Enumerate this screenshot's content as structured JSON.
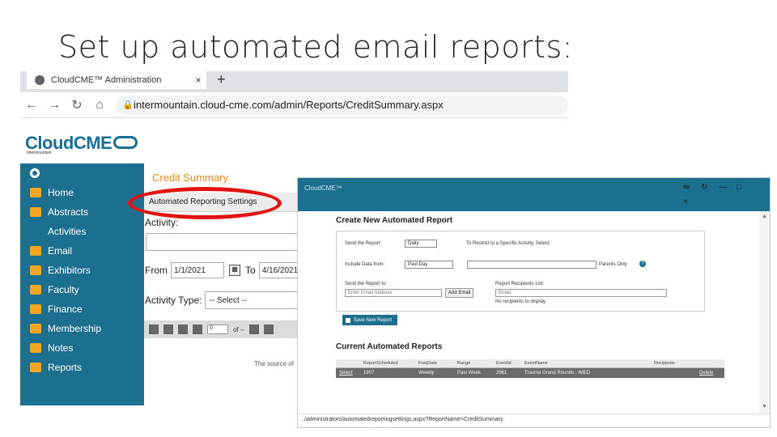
{
  "slide": {
    "title": "Set up automated email reports:"
  },
  "browser": {
    "tab_title": "CloudCME™ Administration",
    "tab_close": "×",
    "new_tab": "+",
    "nav": {
      "back": "←",
      "forward": "→",
      "reload": "↻",
      "home": "⌂"
    },
    "url": "intermountain.cloud-cme.com/admin/Reports/CreditSummary.aspx"
  },
  "site": {
    "logo": "CloudCME",
    "logo_sub": "Intermountain"
  },
  "sidebar": {
    "items": [
      {
        "label": "Home",
        "icon": "location-pin-icon"
      },
      {
        "label": "Abstracts",
        "icon": "book-icon"
      },
      {
        "label": "Activities",
        "icon": ""
      },
      {
        "label": "Email",
        "icon": "envelope-icon"
      },
      {
        "label": "Exhibitors",
        "icon": "grid-icon"
      },
      {
        "label": "Faculty",
        "icon": "person-icon"
      },
      {
        "label": "Finance",
        "icon": "pie-chart-icon"
      },
      {
        "label": "Membership",
        "icon": "group-icon"
      },
      {
        "label": "Notes",
        "icon": "list-icon"
      },
      {
        "label": "Reports",
        "icon": "bar-chart-icon"
      }
    ]
  },
  "main": {
    "heading": "Credit Summary",
    "active_tab": "Automated Reporting Settings",
    "activity_label": "Activity:",
    "from_label": "From",
    "from_date": "1/1/2021",
    "to_label": "To",
    "to_date": "4/16/2021",
    "activity_type_label": "Activity Type:",
    "activity_type_value": "-- Select --",
    "pager_page": "0",
    "pager_of": "of --",
    "source_note": "The source of"
  },
  "popup": {
    "title": "CloudCME™",
    "create_title": "Create New Automated Report",
    "send_report_label": "Send the Report:",
    "send_report_value": "Daily",
    "restrict_label": "To Restrict to a Specific Activity, Select:",
    "include_label": "Include Data from:",
    "include_value": "Past Day",
    "parents_only": "Parents Only",
    "send_to_label": "Send the Report to:",
    "email_placeholder": "Enter Email Address",
    "add_email": "Add Email",
    "recipients_label": "Report Recipients List:",
    "recipients_header": "Email",
    "no_recipients": "No recipients to display",
    "save_button": "Save New Report",
    "current_title": "Current Automated Reports",
    "columns": [
      "",
      "ReportScheduled",
      "FreqDate",
      "Range",
      "EventId",
      "EventName",
      "Recipients",
      ""
    ],
    "rows": [
      [
        "Select",
        "1907",
        "Weekly",
        "Past Week",
        "2961",
        "Trauma Grand Rounds : IMED",
        "",
        "Delete"
      ]
    ],
    "status_url": "../administrators/automatedreportingsettings.aspx?ReportName=CreditSummary"
  },
  "colors": {
    "brand_teal": "#1d6f8f",
    "heading_orange": "#e28a1c",
    "annotation_red": "#e01212",
    "icon_orange": "#f0a623"
  }
}
